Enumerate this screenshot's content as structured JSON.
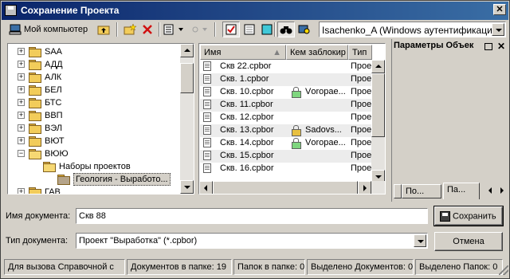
{
  "window": {
    "title": "Сохранение Проекта",
    "close_glyph": "✕"
  },
  "toolbar": {
    "my_computer_label": "Мой компьютер",
    "user_combo_value": "Isachenko_A (Windows аутентификация)",
    "icons": [
      "computer-icon",
      "up-folder-icon",
      "new-folder-icon",
      "delete-icon",
      "view-menu-icon",
      "disabled-icon",
      "check-icon",
      "document-icon",
      "square-icon",
      "binoculars-icon",
      "find-icon"
    ]
  },
  "tree": {
    "items": [
      {
        "label": "SAA",
        "expanded": false
      },
      {
        "label": "АДД",
        "expanded": false
      },
      {
        "label": "АЛК",
        "expanded": false
      },
      {
        "label": "БЕЛ",
        "expanded": false
      },
      {
        "label": "БТС",
        "expanded": false
      },
      {
        "label": "ВВП",
        "expanded": false
      },
      {
        "label": "ВЭЛ",
        "expanded": false
      },
      {
        "label": "ВЮТ",
        "expanded": false
      },
      {
        "label": "ВЮЮ",
        "expanded": true
      },
      {
        "label": "Наборы проектов",
        "expanded": true
      },
      {
        "label": "Геология - Выработо...",
        "selected": true
      },
      {
        "label": "ГАВ",
        "expanded": false
      }
    ]
  },
  "list": {
    "columns": [
      "Имя",
      "Кем заблокир",
      "Тип"
    ],
    "rows": [
      {
        "name": "Скв 22.cpbor",
        "locked_by": "",
        "lock": "",
        "type": "Проек"
      },
      {
        "name": "Скв. 1.cpbor",
        "locked_by": "",
        "lock": "",
        "type": "Проек"
      },
      {
        "name": "Скв. 10.cpbor",
        "locked_by": "Vоropae...",
        "lock": "green",
        "type": "Проек"
      },
      {
        "name": "Скв. 11.cpbor",
        "locked_by": "",
        "lock": "",
        "type": "Проек"
      },
      {
        "name": "Скв. 12.cpbor",
        "locked_by": "",
        "lock": "",
        "type": "Проек"
      },
      {
        "name": "Скв. 13.cpbor",
        "locked_by": "Sadovs...",
        "lock": "yellow",
        "type": "Проек"
      },
      {
        "name": "Скв. 14.cpbor",
        "locked_by": "Vоropae...",
        "lock": "green",
        "type": "Проек"
      },
      {
        "name": "Скв. 15.cpbor",
        "locked_by": "",
        "lock": "",
        "type": "Проек"
      },
      {
        "name": "Скв. 16.cpbor",
        "locked_by": "",
        "lock": "",
        "type": "Проек"
      }
    ]
  },
  "props": {
    "title": "Параметры Объек",
    "pin_glyph": "",
    "close_glyph": "✕",
    "tabs": [
      "По...",
      "Па..."
    ]
  },
  "form": {
    "doc_name_label": "Имя документа:",
    "doc_name_value": "Скв 88",
    "doc_type_label": "Тип документа:",
    "doc_type_value": "Проект \"Выработка\" (*.cpbor)",
    "save_label": "Сохранить",
    "cancel_label": "Отмена"
  },
  "status": {
    "help": "Для вызова Справочной с",
    "docs_in_folder": "Документов в папке: 19",
    "folders_in_folder": "Папок в папке: 0",
    "selected_docs": "Выделено Документов: 0",
    "selected_folders": "Выделено Папок: 0"
  }
}
